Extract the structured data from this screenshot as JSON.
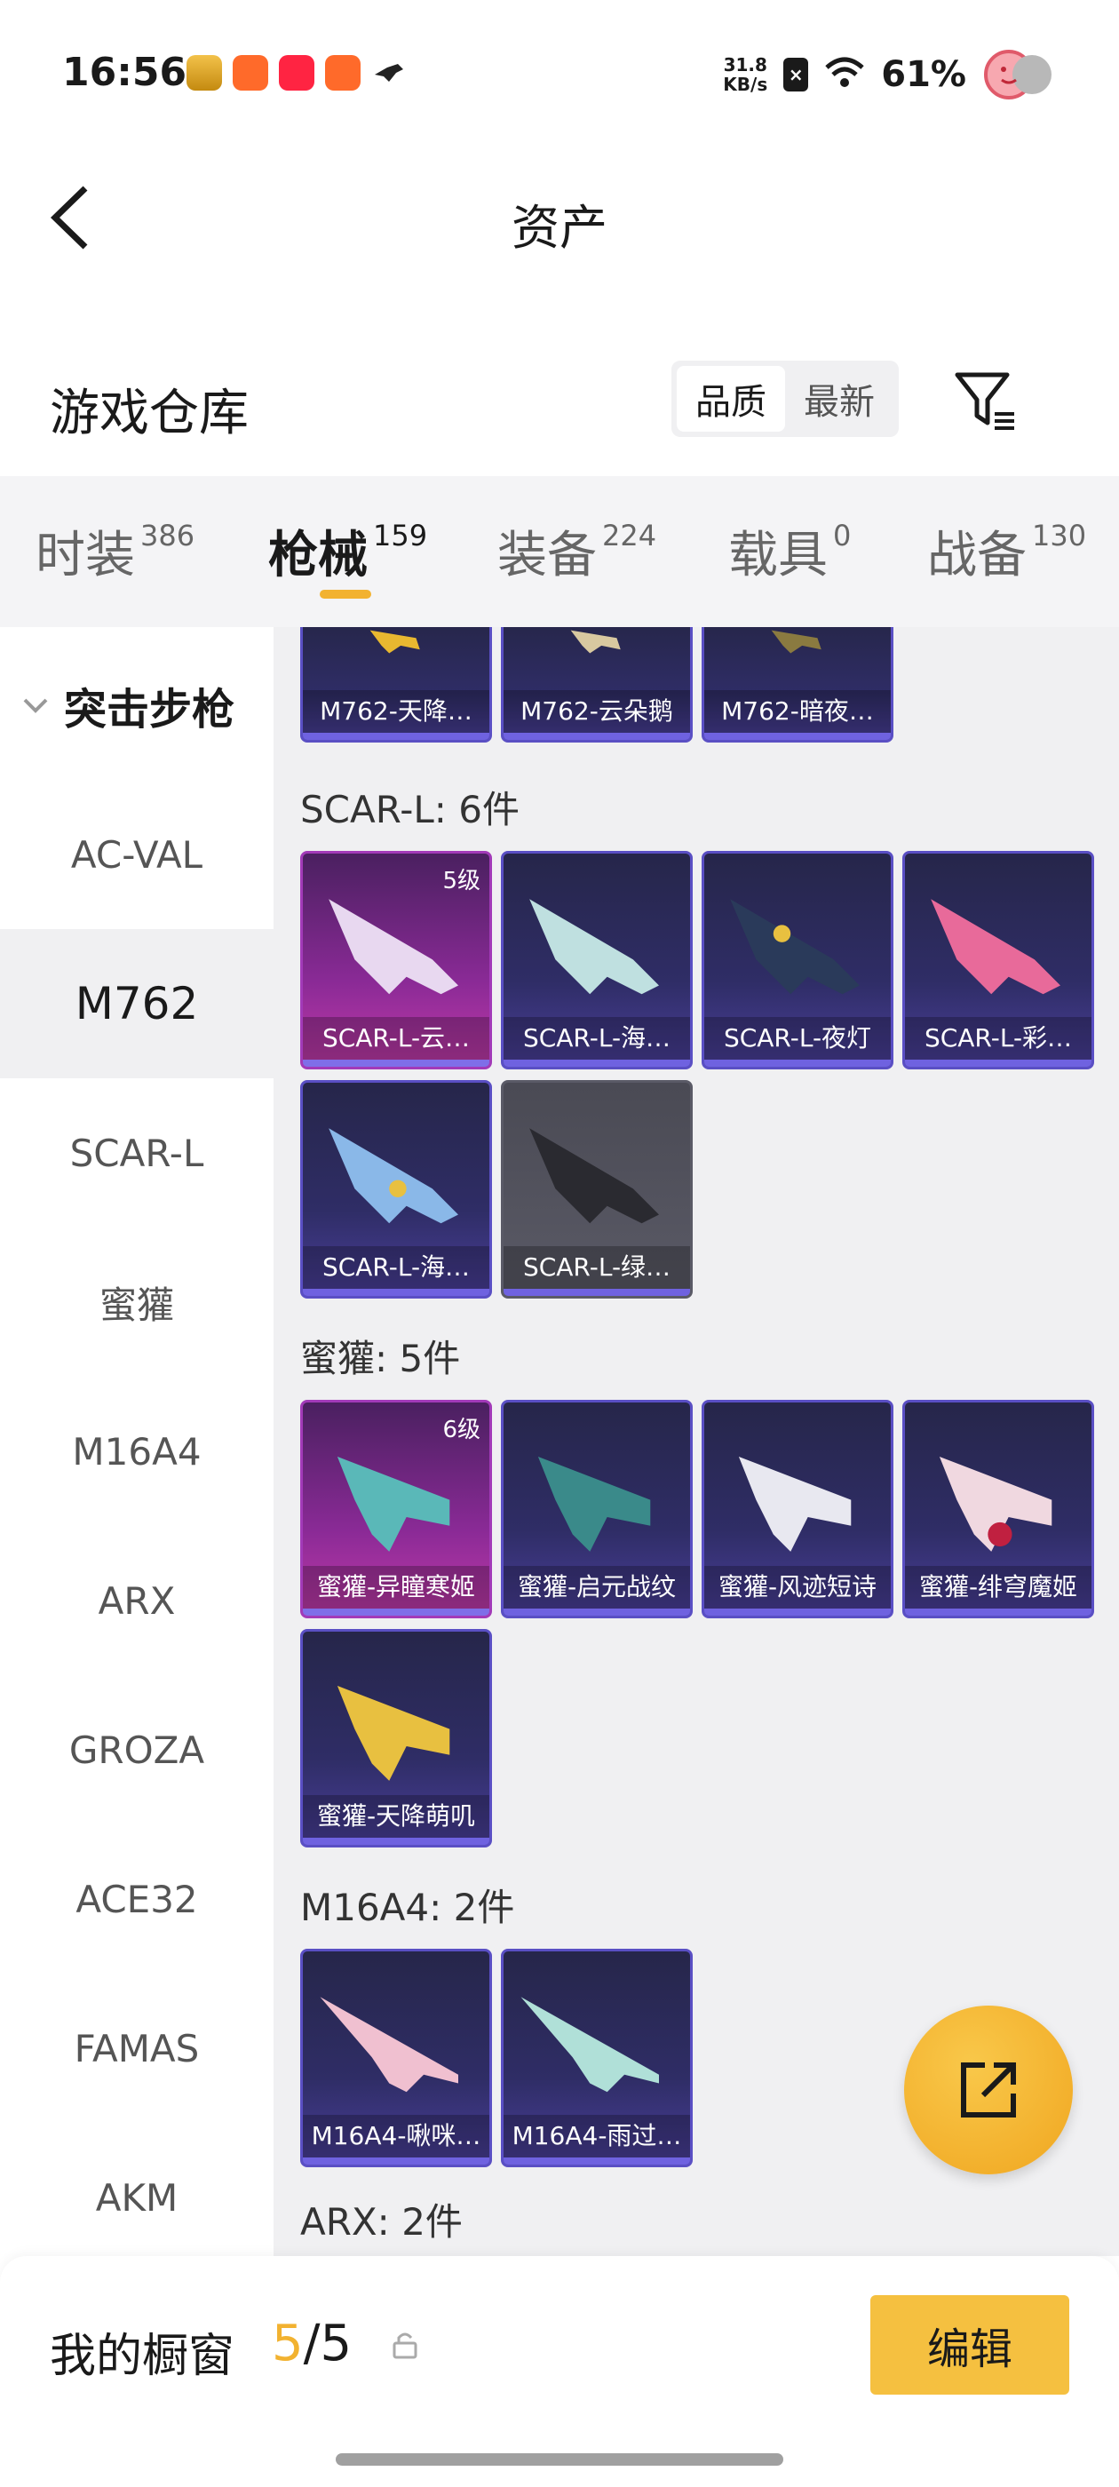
{
  "status_bar": {
    "time": "16:56",
    "net_speed_value": "31.8",
    "net_speed_unit": "KB/s",
    "battery": "61%"
  },
  "header": {
    "title": "资产"
  },
  "section": {
    "title": "游戏仓库",
    "sort_options": [
      "品质",
      "最新"
    ]
  },
  "tabs": [
    {
      "label": "时装",
      "count": "386"
    },
    {
      "label": "枪械",
      "count": "159"
    },
    {
      "label": "装备",
      "count": "224"
    },
    {
      "label": "载具",
      "count": "0"
    },
    {
      "label": "战备",
      "count": "130"
    }
  ],
  "sidebar": {
    "group": "突击步枪",
    "items": [
      "AC-VAL",
      "M762",
      "SCAR-L",
      "蜜獾",
      "M16A4",
      "ARX",
      "GROZA",
      "ACE32",
      "FAMAS",
      "AKM"
    ]
  },
  "groups": {
    "m762": {
      "cards": [
        "M762-天降…",
        "M762-云朵鹅",
        "M762-暗夜…"
      ]
    },
    "scar": {
      "label": "SCAR-L: 6件",
      "cards": [
        "SCAR-L-云…",
        "SCAR-L-海…",
        "SCAR-L-夜灯",
        "SCAR-L-彩…",
        "SCAR-L-海…",
        "SCAR-L-绿…"
      ],
      "level": "5级"
    },
    "honey": {
      "label": "蜜獾: 5件",
      "cards": [
        "蜜獾-异瞳寒姬",
        "蜜獾-启元战纹",
        "蜜獾-风迹短诗",
        "蜜獾-绯穹魔姬",
        "蜜獾-天降萌叽"
      ],
      "level": "6级"
    },
    "m16": {
      "label": "M16A4: 2件",
      "cards": [
        "M16A4-啾咪…",
        "M16A4-雨过…"
      ]
    },
    "arx": {
      "label": "ARX: 2件"
    }
  },
  "bottom": {
    "label": "我的橱窗",
    "current": "5",
    "total": "/5",
    "edit": "编辑"
  },
  "colors": {
    "accent": "#f2b230",
    "card_blue": "#2f2d66",
    "card_pink": "#8a2a96"
  }
}
